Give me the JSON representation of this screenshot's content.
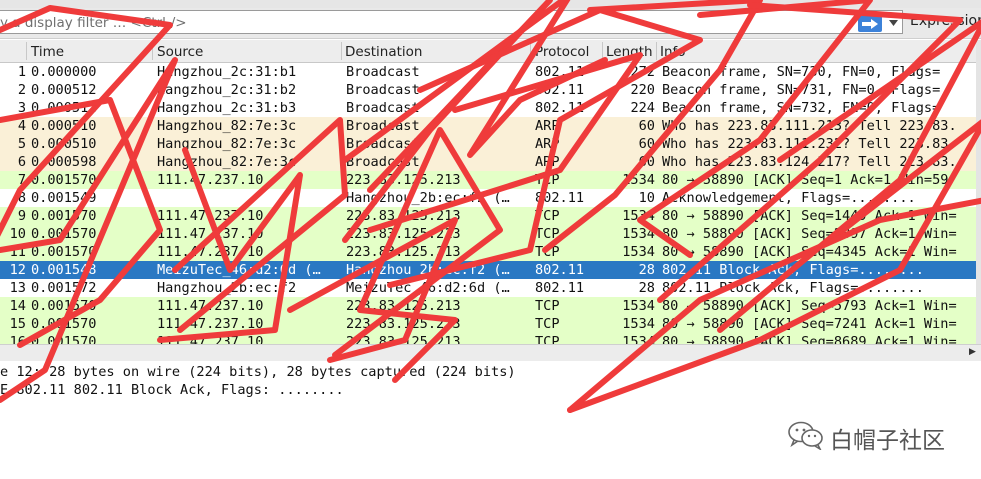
{
  "filter": {
    "placeholder": "y a display filter … <Ctrl-/>",
    "expression_label": "Expression…"
  },
  "columns": [
    "Time",
    "Source",
    "Destination",
    "Protocol",
    "Length",
    "Info"
  ],
  "colors": {
    "beacon_bg": "#ffffff",
    "arp_bg": "#faf0d7",
    "tcp_bg": "#e4ffc7",
    "selected_bg": "#2a78c3",
    "selected_fg": "#ffffff",
    "scribble": "#ef3b3b"
  },
  "packets": [
    {
      "no": "1",
      "time": "0.000000",
      "source": "Hangzhou_2c:31:b1",
      "destination": "Broadcast",
      "protocol": "802.11",
      "length": "272",
      "info": "Beacon frame, SN=730, FN=0, Flags=",
      "kind": "wlan"
    },
    {
      "no": "2",
      "time": "0.000512",
      "source": "Hangzhou_2c:31:b2",
      "destination": "Broadcast",
      "protocol": "802.11",
      "length": "220",
      "info": "Beacon frame, SN=731, FN=0, Flags=",
      "kind": "wlan"
    },
    {
      "no": "3",
      "time": "0.000512",
      "source": "Hangzhou_2c:31:b3",
      "destination": "Broadcast",
      "protocol": "802.11",
      "length": "224",
      "info": "Beacon frame, SN=732, FN=0, Flags=",
      "kind": "wlan"
    },
    {
      "no": "4",
      "time": "0.000510",
      "source": "Hangzhou_82:7e:3c",
      "destination": "Broadcast",
      "protocol": "ARP",
      "length": "60",
      "info": "Who has 223.83.111.213? Tell 223.83.",
      "kind": "arp"
    },
    {
      "no": "5",
      "time": "0.000510",
      "source": "Hangzhou_82:7e:3c",
      "destination": "Broadcast",
      "protocol": "ARP",
      "length": "60",
      "info": "Who has 223.83.111.232? Tell 223.83.",
      "kind": "arp"
    },
    {
      "no": "6",
      "time": "0.000598",
      "source": "Hangzhou_82:7e:3c",
      "destination": "Broadcast",
      "protocol": "ARP",
      "length": "60",
      "info": "Who has 223.83.124.217? Tell 223.83.",
      "kind": "arp"
    },
    {
      "no": "7",
      "time": "0.001570",
      "source": "111.47.237.10",
      "destination": "223.83.125.213",
      "protocol": "TCP",
      "length": "1534",
      "info": "80 → 58890 [ACK] Seq=1 Ack=1 Win=59",
      "kind": "tcp"
    },
    {
      "no": "8",
      "time": "0.001549",
      "source": "",
      "destination": "Hangzhou_2b:ec:f2 (…",
      "protocol": "802.11",
      "length": "10",
      "info": "Acknowledgement, Flags=........",
      "kind": "wlan"
    },
    {
      "no": "9",
      "time": "0.001570",
      "source": "111.47.237.10",
      "destination": "223.83.125.213",
      "protocol": "TCP",
      "length": "1534",
      "info": "80 → 58890 [ACK] Seq=1449 Ack=1 Win=",
      "kind": "tcp"
    },
    {
      "no": "10",
      "time": "0.001570",
      "source": "111.47.237.10",
      "destination": "223.83.125.213",
      "protocol": "TCP",
      "length": "1534",
      "info": "80 → 58890 [ACK] Seq=2897 Ack=1 Win=",
      "kind": "tcp"
    },
    {
      "no": "11",
      "time": "0.001570",
      "source": "111.47.237.10",
      "destination": "223.83.125.213",
      "protocol": "TCP",
      "length": "1534",
      "info": "80 → 58890 [ACK] Seq=4345 Ack=1 Win=",
      "kind": "tcp"
    },
    {
      "no": "12",
      "time": "0.001548",
      "source": "MeizuTec_46:d2:6d (…",
      "destination": "Hangzhou_2b:ec:f2 (…",
      "protocol": "802.11",
      "length": "28",
      "info": "802.11 Block Ack, Flags=........",
      "kind": "selected"
    },
    {
      "no": "13",
      "time": "0.001572",
      "source": "Hangzhou_2b:ec:f2",
      "destination": "MeizuTec_46:d2:6d (…",
      "protocol": "802.11",
      "length": "28",
      "info": "802.11 Block Ack, Flags=........",
      "kind": "wlan"
    },
    {
      "no": "14",
      "time": "0.001570",
      "source": "111.47.237.10",
      "destination": "223.83.125.213",
      "protocol": "TCP",
      "length": "1534",
      "info": "80 → 58890 [ACK] Seq=5793 Ack=1 Win=",
      "kind": "tcp"
    },
    {
      "no": "15",
      "time": "0.001570",
      "source": "111.47.237.10",
      "destination": "223.83.125.213",
      "protocol": "TCP",
      "length": "1534",
      "info": "80 → 58890 [ACK] Seq=7241 Ack=1 Win=",
      "kind": "tcp"
    },
    {
      "no": "16",
      "time": "0.001570",
      "source": "111.47.237.10",
      "destination": "223.83.125.213",
      "protocol": "TCP",
      "length": "1534",
      "info": "80 → 58890 [ACK] Seq=8689 Ack=1 Win=",
      "kind": "tcp"
    }
  ],
  "detail": {
    "frame_line": "e 12: 28 bytes on wire (224 bits), 28 bytes captured (224 bits)",
    "wlan_line": "E 802.11 802.11 Block Ack, Flags: ........"
  },
  "watermark": {
    "text": "白帽子社区",
    "icon": "wechat-icon"
  }
}
